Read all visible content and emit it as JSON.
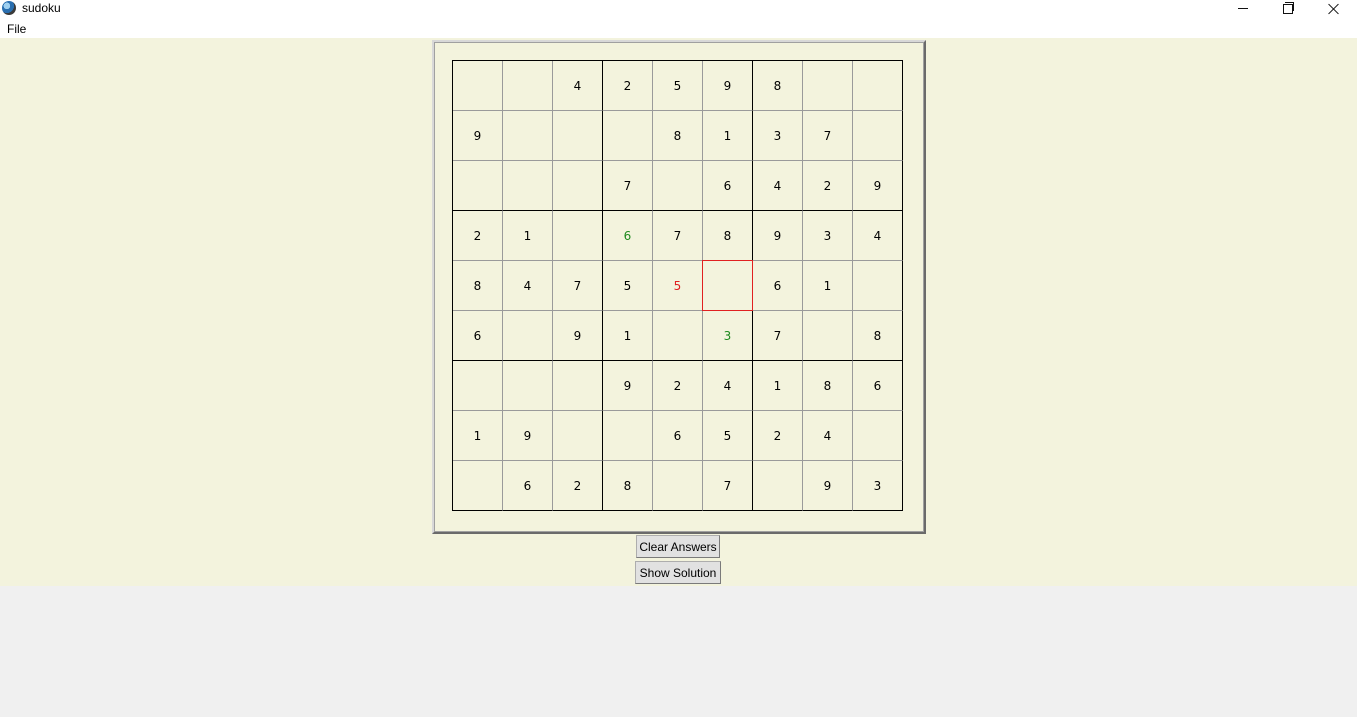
{
  "window": {
    "title": "sudoku",
    "minimize_icon": "minimize-icon",
    "maximize_icon": "restore-icon",
    "close_icon": "close-icon"
  },
  "menu": {
    "file_label": "File"
  },
  "colors": {
    "background": "#f3f3dd",
    "given": "#000000",
    "user_entry": "#1f8a1f",
    "error_entry": "#e02020",
    "selection": "#e02020"
  },
  "board": {
    "rows": [
      [
        "",
        "",
        "4",
        "2",
        "5",
        "9",
        "8",
        "",
        ""
      ],
      [
        "9",
        "",
        "",
        "",
        "8",
        "1",
        "3",
        "7",
        ""
      ],
      [
        "",
        "",
        "",
        "7",
        "",
        "6",
        "4",
        "2",
        "9"
      ],
      [
        "2",
        "1",
        "",
        "6",
        "7",
        "8",
        "9",
        "3",
        "4"
      ],
      [
        "8",
        "4",
        "7",
        "5",
        "5",
        "",
        "6",
        "1",
        ""
      ],
      [
        "6",
        "",
        "9",
        "1",
        "",
        "3",
        "7",
        "",
        "8"
      ],
      [
        "",
        "",
        "",
        "9",
        "2",
        "4",
        "1",
        "8",
        "6"
      ],
      [
        "1",
        "9",
        "",
        "",
        "6",
        "5",
        "2",
        "4",
        ""
      ],
      [
        "",
        "6",
        "2",
        "8",
        "",
        "7",
        "",
        "9",
        "3"
      ]
    ],
    "user_entries": [
      [
        3,
        3
      ],
      [
        5,
        5
      ]
    ],
    "error_entries": [
      [
        4,
        4
      ]
    ],
    "selected_cell": [
      4,
      5
    ]
  },
  "buttons": {
    "clear_label": "Clear Answers",
    "solution_label": "Show Solution"
  }
}
